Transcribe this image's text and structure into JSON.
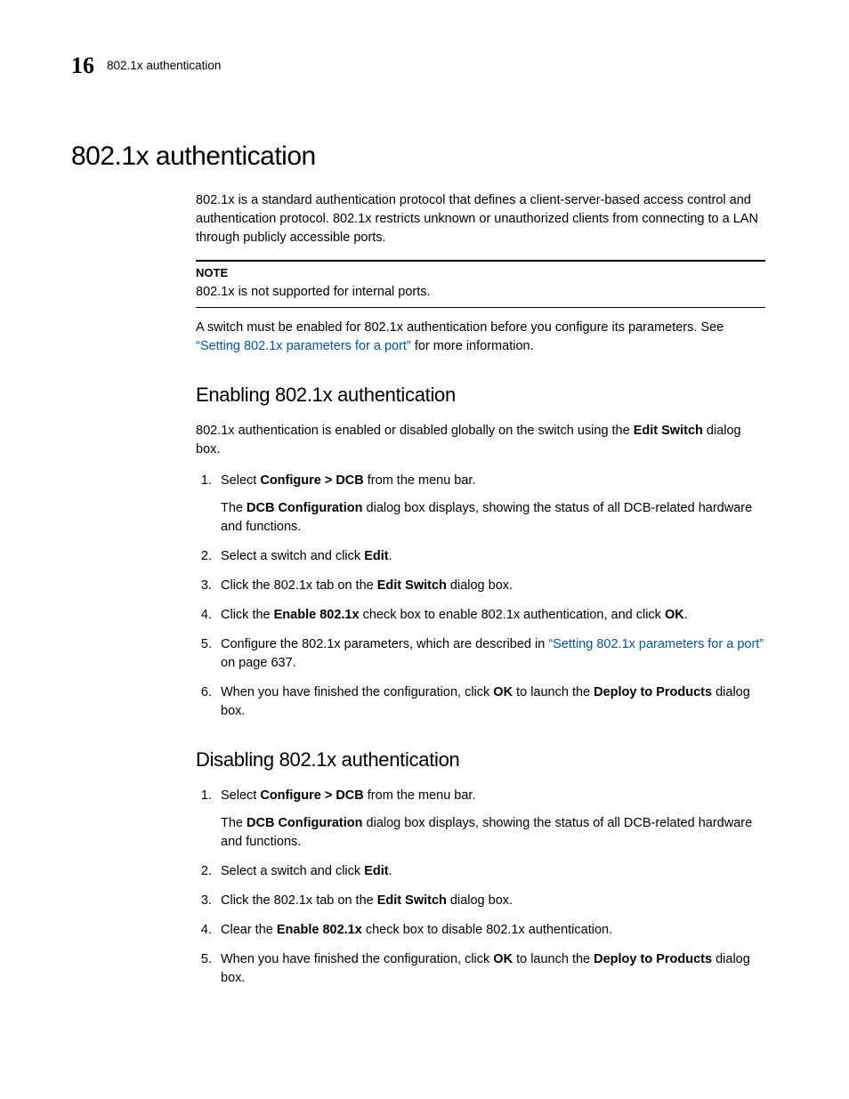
{
  "header": {
    "chapter_number": "16",
    "running_title": "802.1x authentication"
  },
  "h1": "802.1x authentication",
  "intro": "802.1x is a standard authentication protocol that defines a client-server-based access control and authentication protocol. 802.1x restricts unknown or unauthorized clients from connecting to a LAN through publicly accessible ports.",
  "note": {
    "label": "NOTE",
    "text": "802.1x is not supported for internal ports."
  },
  "after_note_pre": "A switch must be enabled for 802.1x authentication before you configure its parameters. See ",
  "after_note_link": "“Setting 802.1x parameters for a port”",
  "after_note_post": " for more information.",
  "section_enable": {
    "heading": "Enabling 802.1x authentication",
    "intro_pre": "802.1x authentication is enabled or disabled globally on the switch using the ",
    "intro_bold": "Edit Switch",
    "intro_post": " dialog box.",
    "steps": {
      "s1_pre": "Select ",
      "s1_bold": "Configure > DCB",
      "s1_post": " from the menu bar.",
      "s1_detail_pre": "The ",
      "s1_detail_bold": "DCB Configuration",
      "s1_detail_post": " dialog box displays, showing the status of all DCB-related hardware and functions.",
      "s2_pre": "Select a switch and click ",
      "s2_bold": "Edit",
      "s2_post": ".",
      "s3_pre": "Click the 802.1x tab on the ",
      "s3_bold": "Edit Switch",
      "s3_post": " dialog box.",
      "s4_pre": "Click the ",
      "s4_bold1": "Enable 802.1x",
      "s4_mid": " check box to enable 802.1x authentication, and click ",
      "s4_bold2": "OK",
      "s4_post": ".",
      "s5_pre": "Configure the 802.1x parameters, which are described in ",
      "s5_link": "“Setting 802.1x parameters for a port”",
      "s5_post": " on page 637.",
      "s6_pre": "When you have finished the configuration, click ",
      "s6_bold1": "OK",
      "s6_mid": " to launch the ",
      "s6_bold2": "Deploy to Products",
      "s6_post": " dialog box."
    }
  },
  "section_disable": {
    "heading": "Disabling 802.1x authentication",
    "steps": {
      "s1_pre": "Select ",
      "s1_bold": "Configure > DCB",
      "s1_post": " from the menu bar.",
      "s1_detail_pre": "The ",
      "s1_detail_bold": "DCB Configuration",
      "s1_detail_post": " dialog box displays, showing the status of all DCB-related hardware and functions.",
      "s2_pre": "Select a switch and click ",
      "s2_bold": "Edit",
      "s2_post": ".",
      "s3_pre": "Click the 802.1x tab on the ",
      "s3_bold": "Edit Switch",
      "s3_post": " dialog box.",
      "s4_pre": "Clear the ",
      "s4_bold": "Enable 802.1x",
      "s4_post": " check box to disable 802.1x authentication.",
      "s5_pre": "When you have finished the configuration, click ",
      "s5_bold1": "OK",
      "s5_mid": " to launch the ",
      "s5_bold2": "Deploy to Products",
      "s5_post": " dialog box."
    }
  }
}
